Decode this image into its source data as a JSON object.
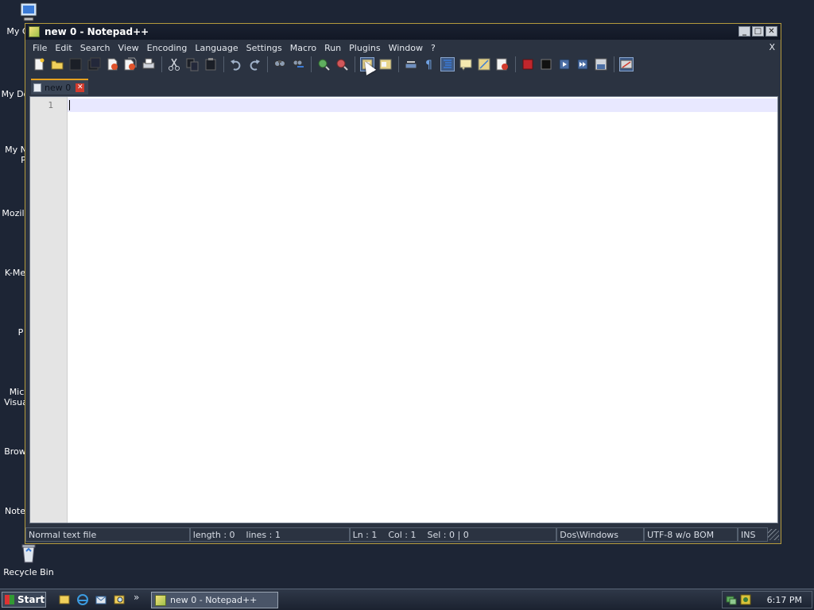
{
  "desktop": {
    "icons": [
      {
        "label": "My C"
      },
      {
        "label": "My Do"
      },
      {
        "label": "My N",
        "label2": "Pl"
      },
      {
        "label": "Mozill"
      },
      {
        "label": "K-Me"
      },
      {
        "label": "P"
      },
      {
        "label": "Mic",
        "label2": "Visua"
      },
      {
        "label": "Brow"
      },
      {
        "label": "Note"
      },
      {
        "label": "Recycle Bin"
      }
    ]
  },
  "window": {
    "title": "new  0 - Notepad++",
    "controls": {
      "minimize": "_",
      "maximize": "□",
      "close": "✕"
    },
    "menu": [
      "File",
      "Edit",
      "Search",
      "View",
      "Encoding",
      "Language",
      "Settings",
      "Macro",
      "Run",
      "Plugins",
      "Window",
      "?"
    ],
    "menu_close": "X",
    "toolbar": [
      "new-file-icon",
      "open-file-icon",
      "save-icon",
      "save-all-icon",
      "close-icon",
      "close-all-icon",
      "print-icon",
      "cut-icon",
      "copy-icon",
      "paste-icon",
      "undo-icon",
      "redo-icon",
      "find-icon",
      "replace-icon",
      "zoom-in-icon",
      "zoom-out-icon",
      "sync-vertical-icon",
      "sync-horizontal-icon",
      "word-wrap-icon",
      "show-all-chars-icon",
      "indent-guide-icon",
      "user-lang-icon",
      "doc-map-icon",
      "function-list-icon",
      "record-macro-icon",
      "stop-macro-icon",
      "play-macro-icon",
      "run-macro-multiple-icon",
      "save-macro-icon",
      "spell-check-icon"
    ],
    "tab": {
      "label": "new  0",
      "close": "✕"
    },
    "editor": {
      "line_numbers": [
        "1"
      ],
      "content": ""
    },
    "status": {
      "file_type": "Normal text file",
      "length": "length : 0",
      "lines": "lines : 1",
      "position": "Ln : 1    Col : 1    Sel : 0 | 0",
      "eol": "Dos\\Windows",
      "encoding": "UTF-8 w/o BOM",
      "mode": "INS"
    }
  },
  "taskbar": {
    "start_label": "Start",
    "chevron": "»",
    "task_label": "new  0 - Notepad++",
    "clock": "6:17 PM"
  },
  "colors": {
    "accent": "#e5a020",
    "window_border": "#b49a3c",
    "desktop": "#1d2535"
  }
}
